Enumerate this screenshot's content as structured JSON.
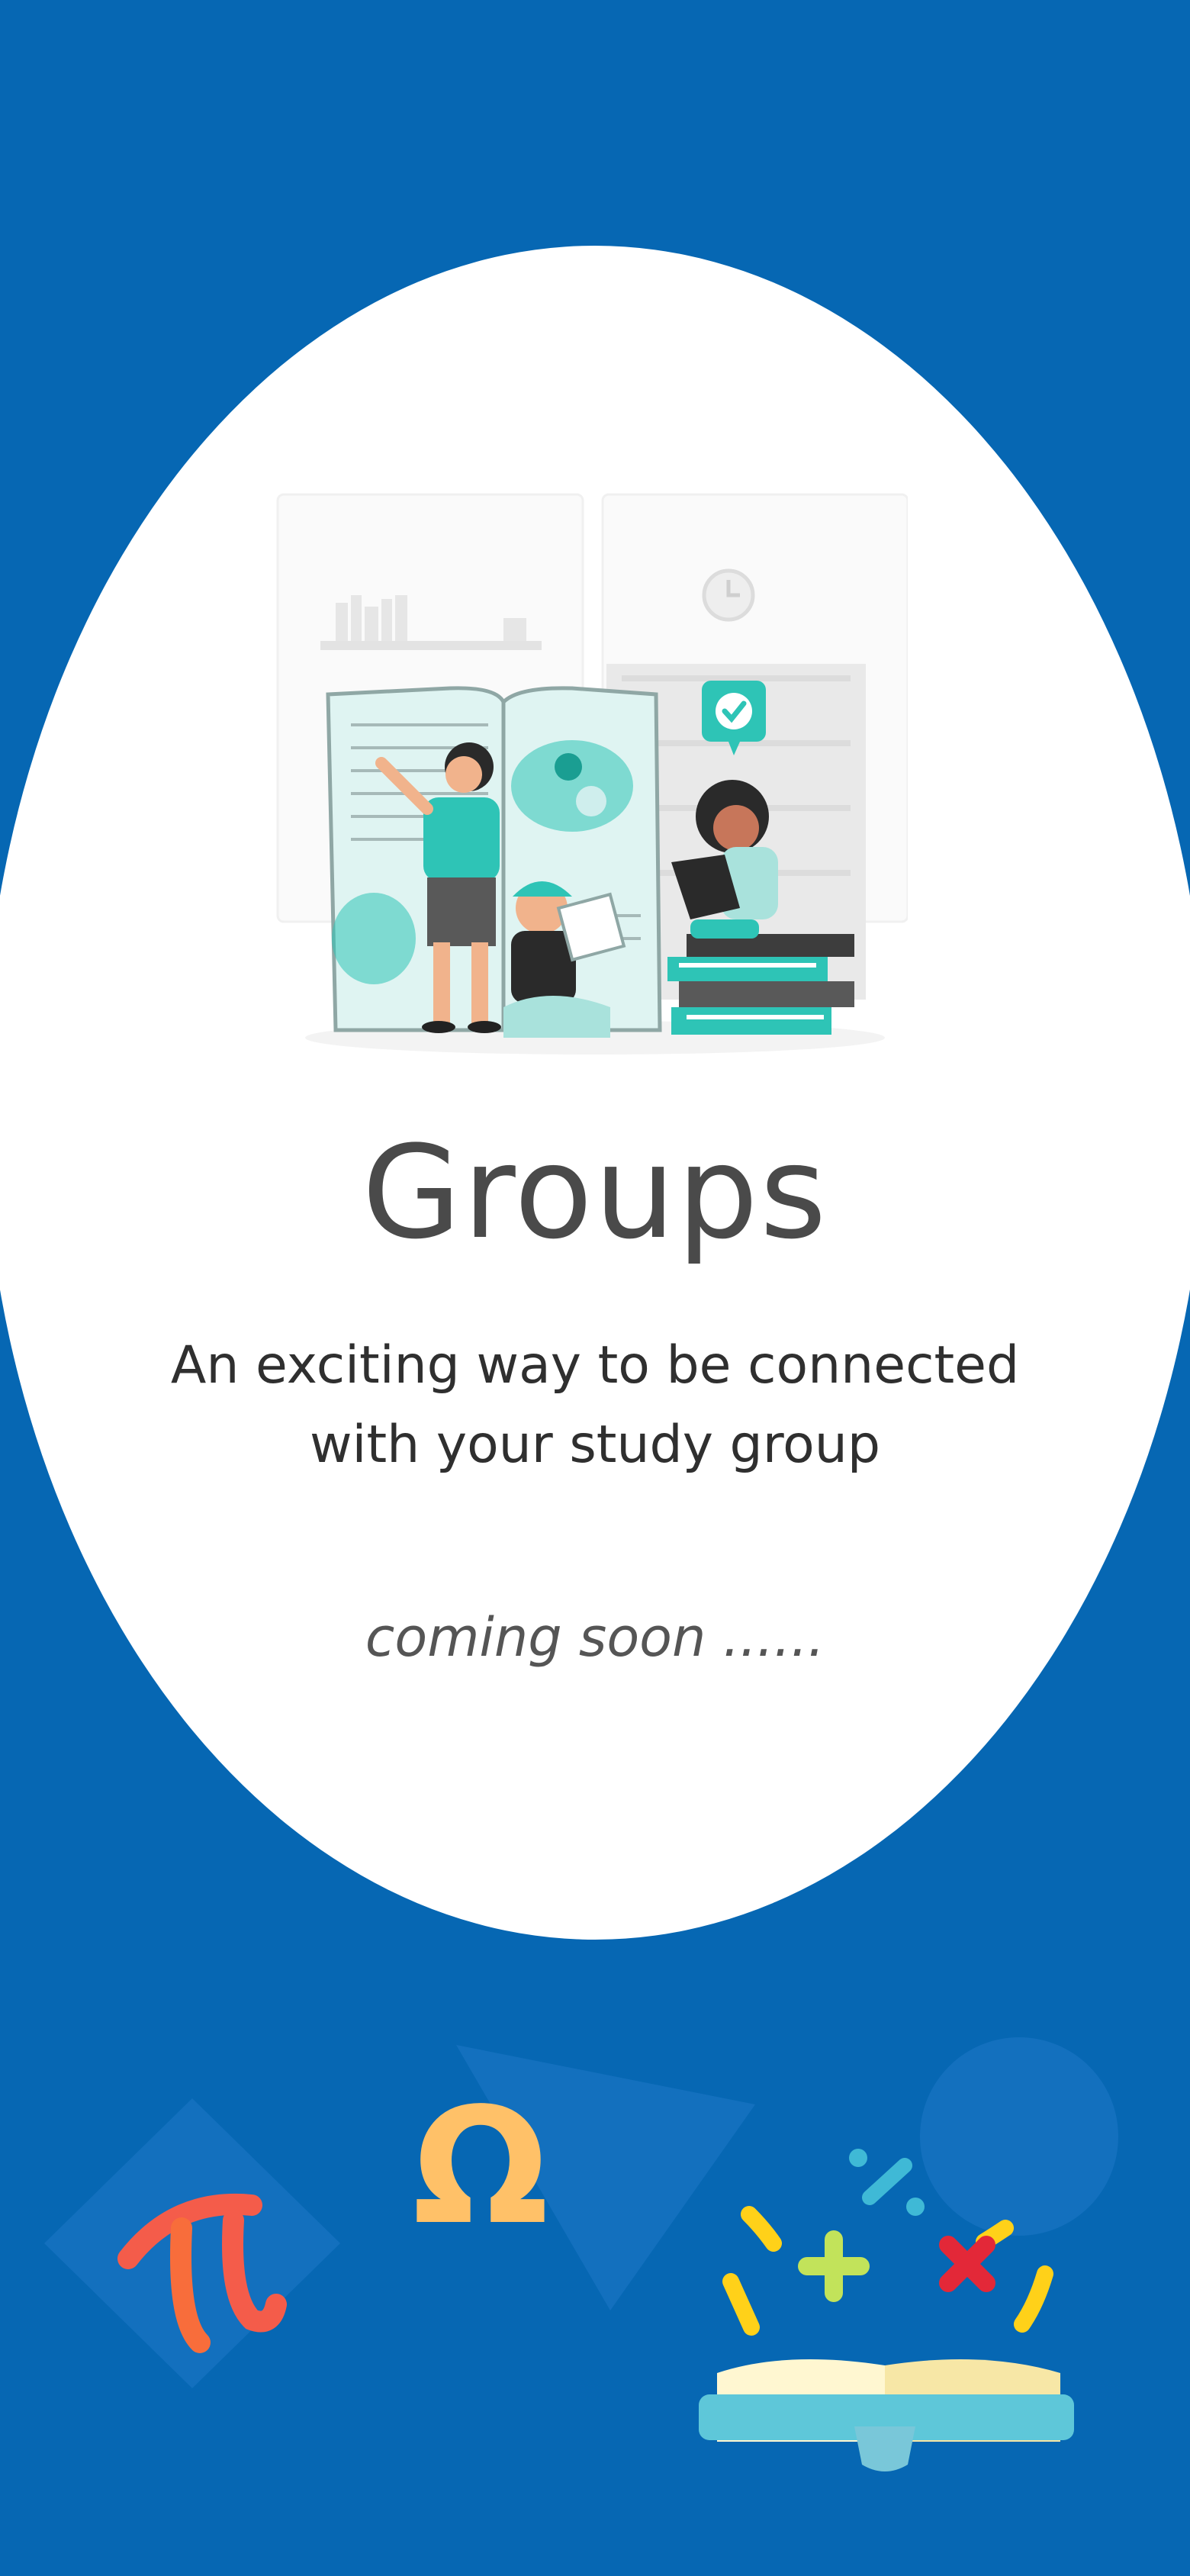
{
  "screen": {
    "title": "Groups",
    "subtitle_line1": "An exciting way to be connected",
    "subtitle_line2": "with your study group",
    "status": "coming soon ......"
  },
  "colors": {
    "background": "#0667b3",
    "card": "#ffffff",
    "accent": "#2ec4b6",
    "title": "#4a4a4a"
  },
  "decorations": {
    "icons": [
      "pi-symbol-icon",
      "omega-symbol-icon",
      "open-book-math-icon",
      "study-group-illustration"
    ],
    "omega_glyph": "Ω"
  }
}
